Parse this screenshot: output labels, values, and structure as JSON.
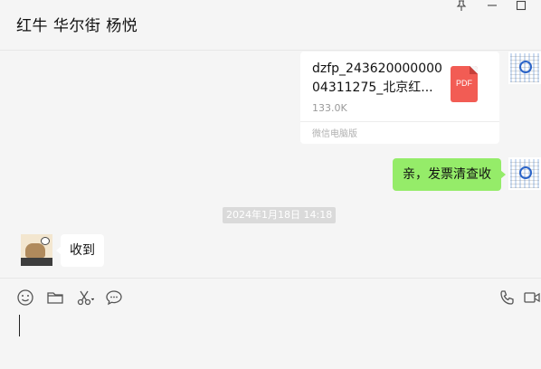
{
  "window": {
    "title": "红牛 华尔街 杨悦",
    "controls": [
      "pin-icon",
      "minimize-icon",
      "maximize-icon"
    ]
  },
  "messages": {
    "file": {
      "name": "dzfp_243620000000 04311275_北京红...",
      "size": "133.0K",
      "source": "微信电脑版",
      "type_label": "PDF",
      "icon_color": "#f25c54"
    },
    "sent_text": "亲，发票清查收",
    "timestamp": "2024年1月18日 14:18",
    "received_text": "收到"
  },
  "colors": {
    "sent_bubble": "#95ec69",
    "received_bubble": "#ffffff",
    "background": "#f5f5f5"
  },
  "toolbar": {
    "icons": [
      "emoji-icon",
      "folder-icon",
      "scissors-icon",
      "chat-history-icon",
      "phone-icon",
      "video-call-icon"
    ]
  }
}
